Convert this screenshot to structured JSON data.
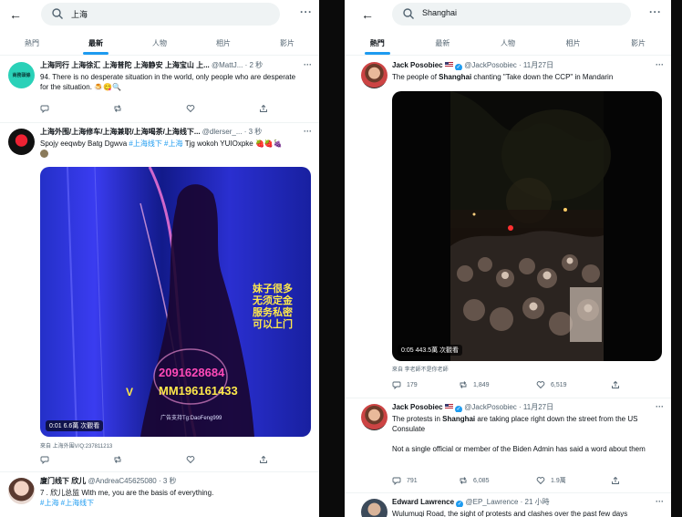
{
  "left": {
    "search_query": "上海",
    "tabs": [
      {
        "label": "熱門",
        "active": false
      },
      {
        "label": "最新",
        "active": true
      },
      {
        "label": "人物",
        "active": false
      },
      {
        "label": "相片",
        "active": false
      },
      {
        "label": "影片",
        "active": false
      }
    ],
    "tweets": [
      {
        "name": "上海同行 上海徐汇 上海普陀 上海静安 上海宝山 上...",
        "handle": "@MattJ...",
        "time": "2 秒",
        "text": "94. There is no desperate situation in the world, only people who are desperate for the situation."
      },
      {
        "name": "上海外围/上海修车/上海兼职/上海喝茶/上海线下...",
        "handle": "@dlerser_...",
        "time": "3 秒",
        "text_pre": "Spojy eeqwby Batg Dgwva ",
        "tags": "#上海线下 #上海",
        "text_post": " Tjg wokoh YUIOxpke 🍓🍓🍇",
        "video_overlay_text": "妹子很多\n无须定金\n服务私密\n可以上门",
        "video_number_1": "2091628684",
        "video_number_2": "MM196161433",
        "video_letter": "V",
        "video_ad": "广告支持Tg:DaoFeng999",
        "video_time": "0:01",
        "video_views": "6.6萬 次觀看",
        "from_label": "來自 上海外围V/Q:237811213"
      },
      {
        "name": "廈门线下 欣儿",
        "handle": "@AndreaC45625080",
        "time": "3 秒",
        "text": "7 . 欣儿总监 With me, you are the basis of everything.",
        "tags": "#上海 #上海线下"
      }
    ]
  },
  "right": {
    "search_query": "Shanghai",
    "tabs": [
      {
        "label": "熱門",
        "active": true
      },
      {
        "label": "最新",
        "active": false
      },
      {
        "label": "人物",
        "active": false
      },
      {
        "label": "相片",
        "active": false
      },
      {
        "label": "影片",
        "active": false
      }
    ],
    "tweets": [
      {
        "name": "Jack Posobiec",
        "handle": "@JackPosobiec",
        "time": "11月27日",
        "text_pre": "The people of ",
        "text_hl": "Shanghai",
        "text_post": " chanting \"Take down the CCP\" in Mandarin",
        "video_time": "0:05",
        "video_views": "443.5萬 次觀看",
        "from_label": "來自 李老師不是你老師",
        "replies": "179",
        "retweets": "1,849",
        "likes": "6,519"
      },
      {
        "name": "Jack Posobiec",
        "handle": "@JackPosobiec",
        "time": "11月27日",
        "text_pre": "The protests in ",
        "text_hl": "Shanghai",
        "text_post": " are taking place right down the street from the US Consulate",
        "text2": "Not a single official or member of the Biden Admin has said a word about them",
        "replies": "791",
        "retweets": "6,085",
        "likes": "1.9萬"
      },
      {
        "name": "Edward Lawrence",
        "handle": "@EP_Lawrence",
        "time": "21 小時",
        "text": "Wulumuqi Road, the sight of protests and clashes over the past few days"
      }
    ]
  },
  "colors": {
    "accent": "#1d9bf0",
    "text": "#0f1419",
    "muted": "#536471",
    "divider": "#eff3f4"
  },
  "icons": [
    "back-arrow-icon",
    "search-icon",
    "more-icon",
    "reply-icon",
    "retweet-icon",
    "like-icon",
    "share-icon",
    "verified-icon"
  ]
}
